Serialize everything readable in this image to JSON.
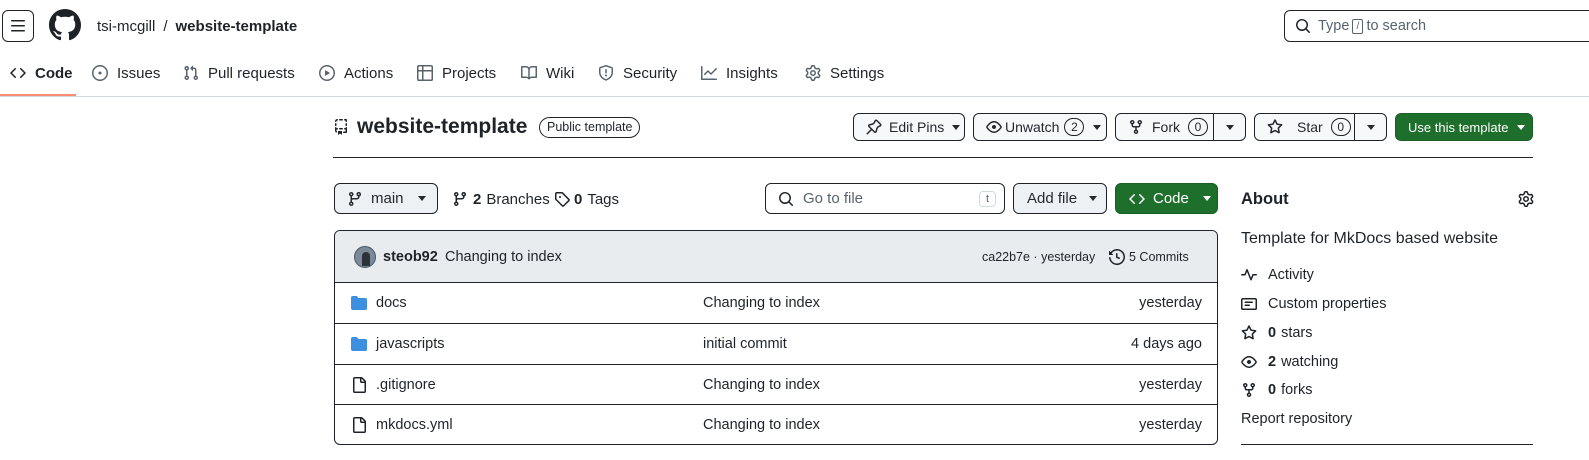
{
  "header": {
    "owner": "tsi-mcgill",
    "separator": "/",
    "repo": "website-template",
    "search": {
      "prefix": "Type",
      "key": "/",
      "suffix": "to search"
    }
  },
  "tabs": [
    {
      "label": "Code",
      "icon": "code-icon",
      "active": true
    },
    {
      "label": "Issues",
      "icon": "issue-opened-icon"
    },
    {
      "label": "Pull requests",
      "icon": "git-pull-request-icon"
    },
    {
      "label": "Actions",
      "icon": "play-icon"
    },
    {
      "label": "Projects",
      "icon": "table-icon"
    },
    {
      "label": "Wiki",
      "icon": "book-icon"
    },
    {
      "label": "Security",
      "icon": "shield-icon"
    },
    {
      "label": "Insights",
      "icon": "graph-icon"
    },
    {
      "label": "Settings",
      "icon": "gear-icon"
    }
  ],
  "repo_header": {
    "name": "website-template",
    "visibility": "Public template",
    "edit_pins": "Edit Pins",
    "unwatch": "Unwatch",
    "watch_count": "2",
    "fork": "Fork",
    "fork_count": "0",
    "star": "Star",
    "star_count": "0",
    "use_template": "Use this template"
  },
  "toolbar": {
    "branch": "main",
    "branches_count": "2",
    "branches_label": "Branches",
    "tags_count": "0",
    "tags_label": "Tags",
    "go_to_file_placeholder": "Go to file",
    "go_to_file_key": "t",
    "add_file": "Add file",
    "code": "Code"
  },
  "latest_commit": {
    "author": "steob92",
    "message": "Changing to index",
    "sha_time": "ca22b7e · yesterday",
    "commits_label": "5 Commits"
  },
  "files": [
    {
      "name": "docs",
      "type": "folder",
      "message": "Changing to index",
      "time": "yesterday"
    },
    {
      "name": "javascripts",
      "type": "folder",
      "message": "initial commit",
      "time": "4 days ago"
    },
    {
      "name": ".gitignore",
      "type": "file",
      "message": "Changing to index",
      "time": "yesterday"
    },
    {
      "name": "mkdocs.yml",
      "type": "file",
      "message": "Changing to index",
      "time": "yesterday"
    }
  ],
  "about": {
    "title": "About",
    "description": "Template for MkDocs based website",
    "activity": "Activity",
    "custom_properties": "Custom properties",
    "stars_count": "0",
    "stars_label": "stars",
    "watching_count": "2",
    "watching_label": "watching",
    "forks_count": "0",
    "forks_label": "forks",
    "report": "Report repository"
  },
  "colors": {
    "primary_green": "#1f6f2c",
    "folder_blue": "#54aeff",
    "active_tab_underline": "#fd8c73",
    "commit_header_bg": "#e9ecef"
  }
}
